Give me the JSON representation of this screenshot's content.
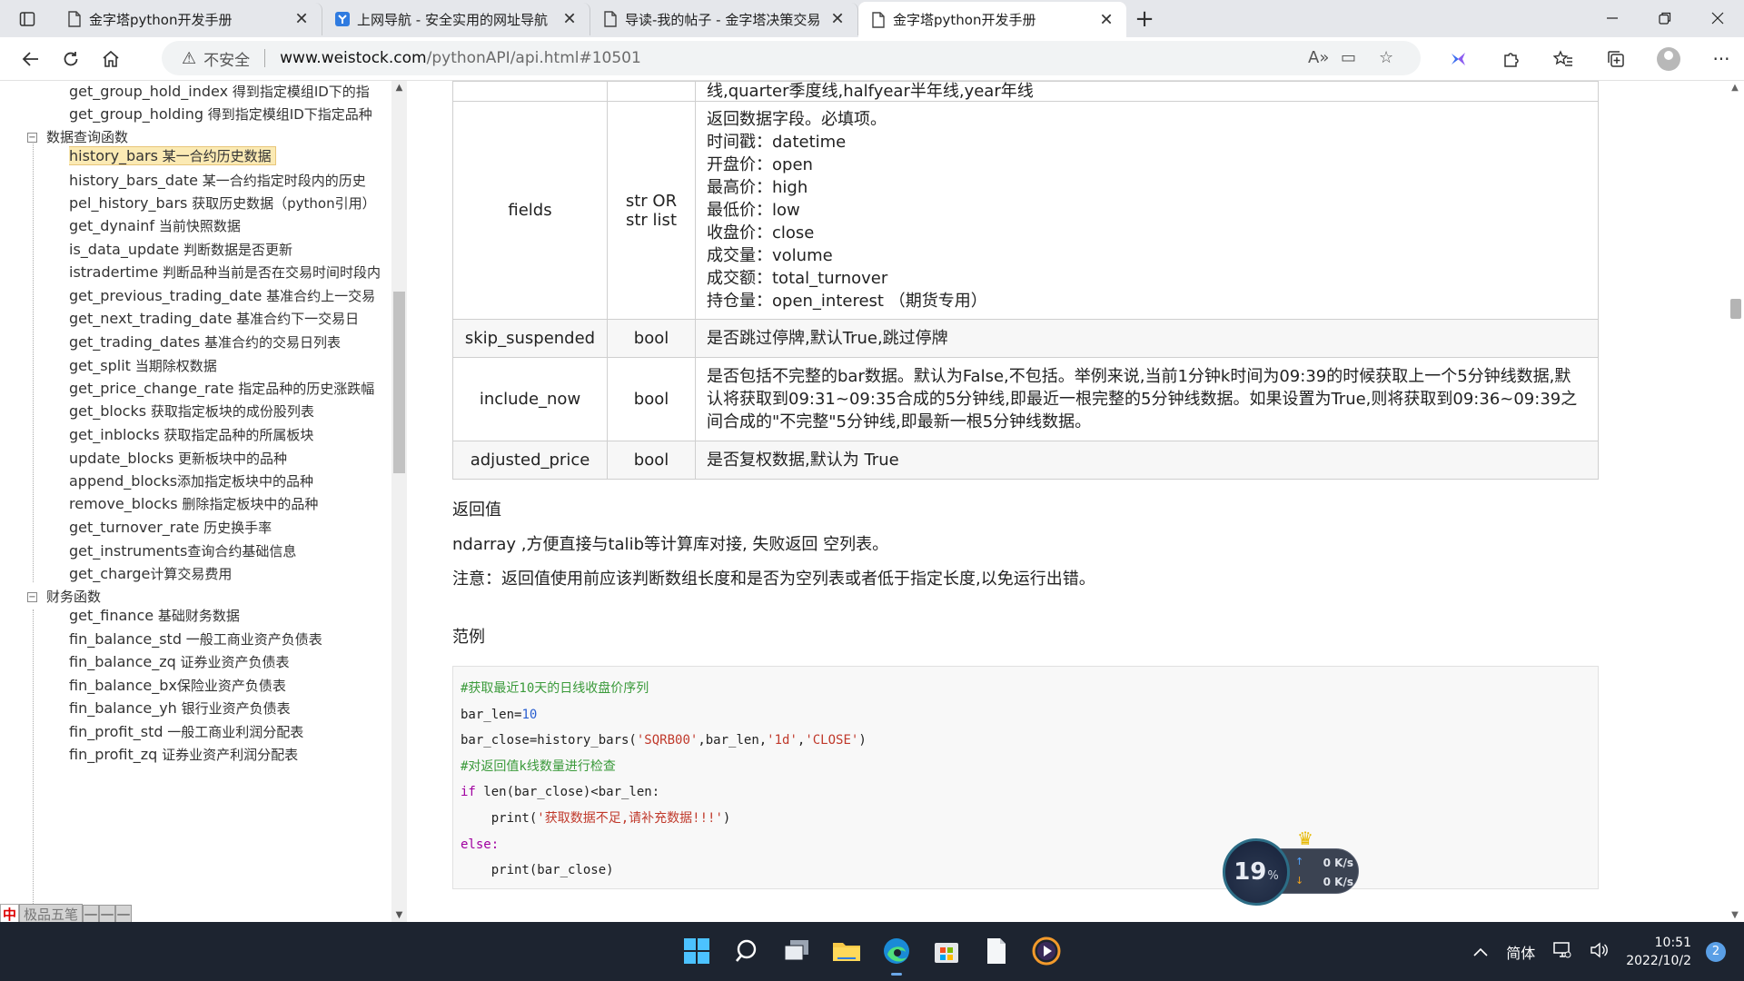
{
  "browser": {
    "tabs": [
      {
        "title": "金字塔python开发手册",
        "active": false
      },
      {
        "title": "上网导航 - 安全实用的网址导航",
        "active": false
      },
      {
        "title": "导读-我的帖子 - 金字塔决策交易",
        "active": false
      },
      {
        "title": "金字塔python开发手册",
        "active": true
      }
    ],
    "new_tab_label": "+",
    "security_label": "不安全",
    "url_host": "www.weistock.com",
    "url_path": "/pythonAPI/api.html#10501"
  },
  "sidebar": {
    "items": [
      {
        "name": "get_group_hold_index",
        "desc": " 得到指定模组ID下的指"
      },
      {
        "name": "get_group_holding",
        "desc": " 得到指定模组ID下指定品种"
      },
      {
        "name": "history_bars",
        "desc": " 某一合约历史数据"
      },
      {
        "name": "history_bars_date",
        "desc": " 某一合约指定时段内的历史"
      },
      {
        "name": "pel_history_bars",
        "desc": " 获取历史数据（python引用）"
      },
      {
        "name": "get_dynainf",
        "desc": " 当前快照数据"
      },
      {
        "name": "is_data_update",
        "desc": " 判断数据是否更新"
      },
      {
        "name": "istradertime",
        "desc": " 判断品种当前是否在交易时间时段内"
      },
      {
        "name": "get_previous_trading_date",
        "desc": " 基准合约上一交易"
      },
      {
        "name": "get_next_trading_date",
        "desc": " 基准合约下一交易日"
      },
      {
        "name": "get_trading_dates",
        "desc": " 基准合约的交易日列表"
      },
      {
        "name": "get_split",
        "desc": " 当期除权数据"
      },
      {
        "name": "get_price_change_rate",
        "desc": " 指定品种的历史涨跌幅"
      },
      {
        "name": "get_blocks",
        "desc": " 获取指定板块的成份股列表"
      },
      {
        "name": "get_inblocks",
        "desc": " 获取指定品种的所属板块"
      },
      {
        "name": "update_blocks",
        "desc": " 更新板块中的品种"
      },
      {
        "name": "append_blocks",
        "desc": "添加指定板块中的品种"
      },
      {
        "name": "remove_blocks",
        "desc": " 删除指定板块中的品种"
      },
      {
        "name": "get_turnover_rate",
        "desc": " 历史换手率"
      },
      {
        "name": "get_instruments",
        "desc": "查询合约基础信息"
      },
      {
        "name": "get_charge",
        "desc": "计算交易费用"
      },
      {
        "name": "get_finance",
        "desc": " 基础财务数据"
      },
      {
        "name": "fin_balance_std",
        "desc": " 一般工商业资产负债表"
      },
      {
        "name": "fin_balance_zq",
        "desc": " 证券业资产负债表"
      },
      {
        "name": "fin_balance_bx",
        "desc": "保险业资产负债表"
      },
      {
        "name": "fin_balance_yh",
        "desc": " 银行业资产负债表"
      },
      {
        "name": "fin_profit_std",
        "desc": " 一般工商业利润分配表"
      },
      {
        "name": "fin_profit_zq",
        "desc": " 证券业资产利润分配表"
      }
    ],
    "groups": [
      {
        "label": "数据查询函数",
        "toggle": "−"
      },
      {
        "label": "财务函数",
        "toggle": "−"
      }
    ],
    "ime": {
      "zh": "中",
      "name": "极品五笔",
      "keys": [
        "—",
        "—",
        "—"
      ]
    }
  },
  "params": {
    "top_fragment": "线,quarter季度线,halfyear半年线,year年线",
    "rows": [
      {
        "name": "fields",
        "type": "str OR str list",
        "desc": [
          "返回数据字段。必填项。",
          "时间戳：datetime",
          "开盘价：open",
          "最高价：high",
          "最低价：low",
          "收盘价：close",
          "成交量：volume",
          "成交额：total_turnover",
          "持仓量：open_interest （期货专用）"
        ]
      },
      {
        "name": "skip_suspended",
        "type": "bool",
        "desc": [
          "是否跳过停牌,默认True,跳过停牌"
        ]
      },
      {
        "name": "include_now",
        "type": "bool",
        "desc": [
          "是否包括不完整的bar数据。默认为False,不包括。举例来说,当前1分钟k时间为09:39的时候获取上一个5分钟线数据,默认将获取到09:31~09:35合成的5分钟线,即最近一根完整的5分钟线数据。如果设置为True,则将获取到09:36~09:39之间合成的\"不完整\"5分钟线,即最新一根5分钟线数据。"
        ]
      },
      {
        "name": "adjusted_price",
        "type": "bool",
        "desc": [
          "是否复权数据,默认为 True"
        ]
      }
    ]
  },
  "doc": {
    "return_heading": "返回值",
    "return_text": " ndarray ,方便直接与talib等计算库对接, 失败返回 空列表。",
    "note_text": "注意：返回值使用前应该判断数组长度和是否为空列表或者低于指定长度,以免运行出错。",
    "example_heading": "范例"
  },
  "code": {
    "comment1": "#获取最近10天的日线收盘价序列",
    "l2_a": "bar_len=",
    "l2_num": "10",
    "l3_a": "bar_close=history_bars(",
    "l3_s1": "'SQRB00'",
    "l3_b": ",bar_len,",
    "l3_s2": "'1d'",
    "l3_c": ",",
    "l3_s3": "'CLOSE'",
    "l3_d": ")",
    "comment2": "#对返回值k线数量进行检查",
    "l5_kw": "if",
    "l5_rest": " len(bar_close)<bar_len:",
    "l6_a": "    print(",
    "l6_s": "'获取数据不足,请补充数据!!!'",
    "l6_b": ")",
    "l7_kw": "else:",
    "l8": "    print(bar_close)"
  },
  "net_widget": {
    "cpu": "19",
    "pct": "%",
    "up": "0 K/s",
    "down": "0 K/s"
  },
  "taskbar": {
    "ime_lang": "简体",
    "time": "10:51",
    "date": "2022/10/2",
    "notifications": "2"
  },
  "colors": {
    "accent": "#3b82d6",
    "highlight": "#fbeab4",
    "taskbar": "#1d2430"
  }
}
